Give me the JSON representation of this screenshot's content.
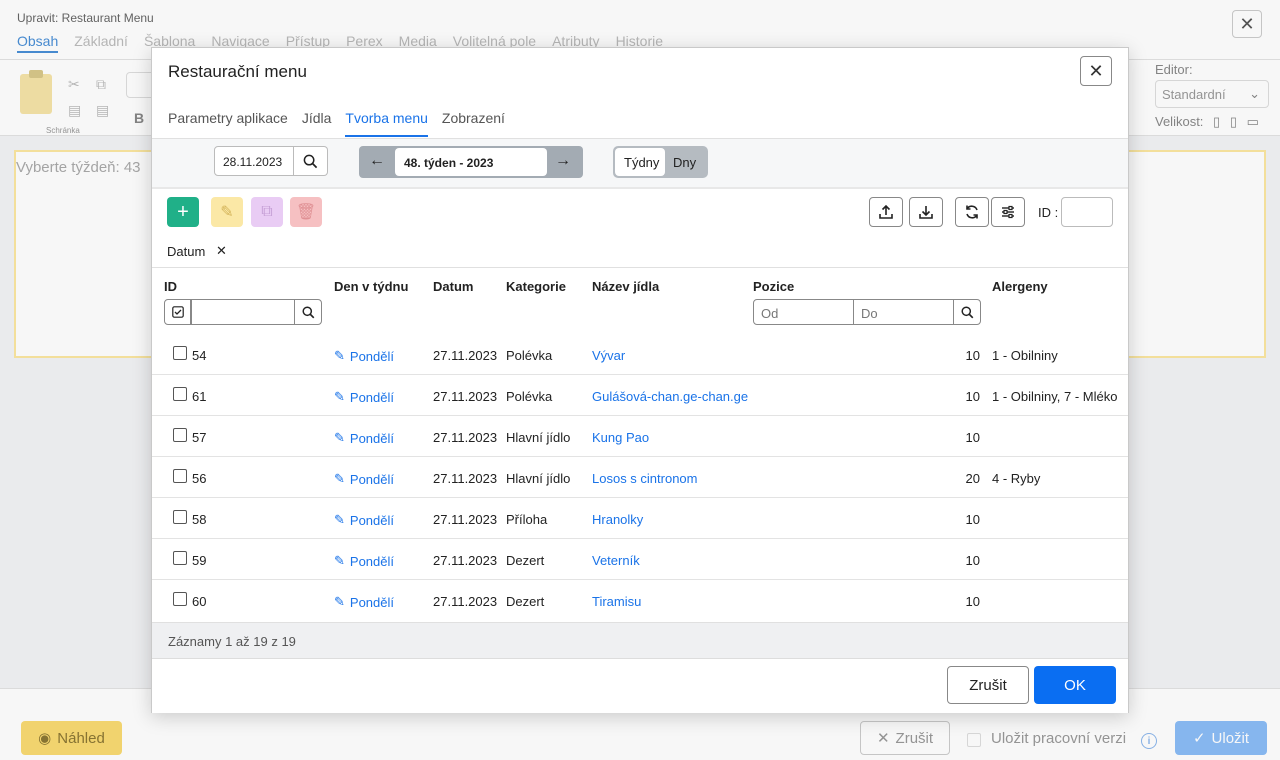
{
  "outer": {
    "title": "Upravit: Restaurant Menu",
    "tabs": [
      "Obsah",
      "Základní",
      "Šablona",
      "Navigace",
      "Přístup",
      "Perex",
      "Media",
      "Volitelná pole",
      "Atributy",
      "Historie"
    ],
    "clipboard_label": "Schránka",
    "editor_label": "Editor:",
    "editor_value": "Standardní",
    "size_label": "Velikost:",
    "week_prompt": "Vyberte týždeň: 43",
    "preview_label": "Náhled",
    "cancel_label": "Zrušit",
    "save_draft_label": "Uložit pracovní verzi",
    "save_label": "Uložit"
  },
  "modal": {
    "title": "Restaurační menu",
    "tabs": [
      "Parametry aplikace",
      "Jídla",
      "Tvorba menu",
      "Zobrazení"
    ],
    "active_tab": "Tvorba menu",
    "date_value": "28.11.2023",
    "week_label": "48. týden - 2023",
    "toggle": [
      "Týdny",
      "Dny"
    ],
    "id_label": "ID :",
    "chip_label": "Datum",
    "columns": [
      "ID",
      "Den v týdnu",
      "Datum",
      "Kategorie",
      "Název jídla",
      "Pozice",
      "Alergeny"
    ],
    "pos_from_placeholder": "Od",
    "pos_to_placeholder": "Do",
    "rows": [
      {
        "id": "54",
        "den": "Pondělí",
        "datum": "27.11.2023",
        "kategorie": "Polévka",
        "nazev": "Vývar",
        "pozice": "10",
        "alergeny": "1 - Obilniny"
      },
      {
        "id": "61",
        "den": "Pondělí",
        "datum": "27.11.2023",
        "kategorie": "Polévka",
        "nazev": "Gulášová-chan.ge-chan.ge",
        "pozice": "10",
        "alergeny": "1 - Obilniny, 7 - Mléko"
      },
      {
        "id": "57",
        "den": "Pondělí",
        "datum": "27.11.2023",
        "kategorie": "Hlavní jídlo",
        "nazev": "Kung Pao",
        "pozice": "10",
        "alergeny": ""
      },
      {
        "id": "56",
        "den": "Pondělí",
        "datum": "27.11.2023",
        "kategorie": "Hlavní jídlo",
        "nazev": "Losos s cintronom",
        "pozice": "20",
        "alergeny": "4 - Ryby"
      },
      {
        "id": "58",
        "den": "Pondělí",
        "datum": "27.11.2023",
        "kategorie": "Příloha",
        "nazev": "Hranolky",
        "pozice": "10",
        "alergeny": ""
      },
      {
        "id": "59",
        "den": "Pondělí",
        "datum": "27.11.2023",
        "kategorie": "Dezert",
        "nazev": "Veterník",
        "pozice": "10",
        "alergeny": ""
      },
      {
        "id": "60",
        "den": "Pondělí",
        "datum": "27.11.2023",
        "kategorie": "Dezert",
        "nazev": "Tiramisu",
        "pozice": "10",
        "alergeny": ""
      }
    ],
    "records_info": "Záznamy 1 až 19 z 19",
    "cancel_label": "Zrušit",
    "ok_label": "OK"
  },
  "colors": {
    "accent": "#1a73e8",
    "ok_button": "#0a6ef2",
    "add_button": "#20b088",
    "edit_button": "#fbe8a6",
    "duplicate_button": "#e9ccf4",
    "delete_button": "#f6c0c2"
  }
}
